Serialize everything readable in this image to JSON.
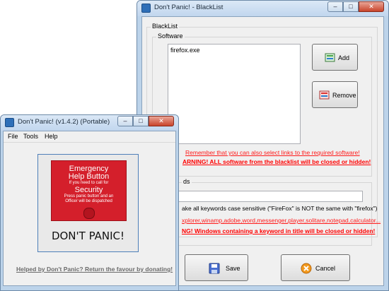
{
  "blacklist_window": {
    "title": "Don't Panic! - BlackList",
    "group_blacklist": "BlackList",
    "group_software": "Software",
    "software_items": [
      "firefox.exe"
    ],
    "add_label": "Add",
    "remove_label": "Remove",
    "hint_link": "Remember that you can also select links to the required software!",
    "warning_software": "ARNING! ALL software from the blacklist will be closed or hidden!",
    "group_keywords_partial": "ds",
    "case_sensitive_label": "ake all keywords case sensitive (\"FireFox\" is NOT the same with \"firefox\")",
    "keyword_examples": "xplorer,winamp,adobe,word,messenger,player,solitare,notepad,calculator...",
    "warning_keywords": "NG! Windows containing a keyword in title will be closed or hidden!",
    "save_label": "Save",
    "cancel_label": "Cancel"
  },
  "main_window": {
    "title": "Don't Panic! (v1.4.2) (Portable)",
    "menu": [
      "File",
      "Tools",
      "Help"
    ],
    "panic_button": {
      "line1": "Emergency",
      "line2": "Help Button",
      "line3": "If you need to call for",
      "line4": "Security",
      "line5": "Press panic button and an",
      "line6": "Officer will be dispatched",
      "caption": "DON'T PANIC!"
    },
    "donate_link": "Helped by Don't Panic? Return the favour by donating!"
  },
  "caption_buttons": {
    "minimize": "‒",
    "maximize": "□",
    "close": "✕"
  },
  "colors": {
    "link_red": "#ff0000",
    "panic_red": "#d41f2b",
    "title_text": "#1c2b3a"
  }
}
